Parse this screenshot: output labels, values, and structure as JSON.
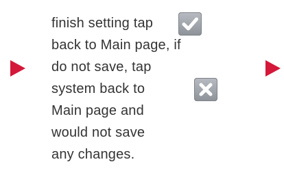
{
  "instructions": {
    "lines": [
      "finish setting tap",
      "back to Main page,  if",
      "do not save, tap",
      "system back to",
      "Main page and",
      "would not save",
      "any changes."
    ]
  },
  "icons": {
    "save": "check-icon",
    "cancel": "close-icon"
  },
  "colors": {
    "arrow": "#d4183a",
    "icon_bg": "#9da1a7",
    "text": "#333333"
  }
}
